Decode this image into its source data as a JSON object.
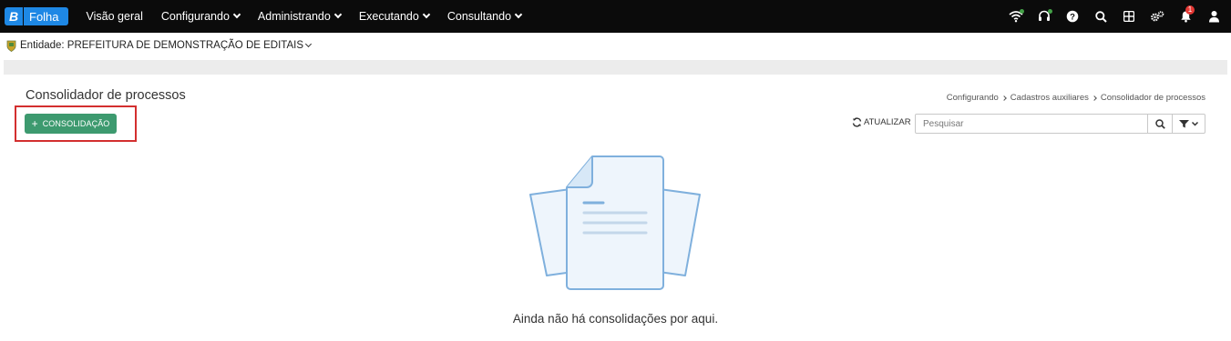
{
  "app": {
    "logo_letter": "B",
    "name": "Folha"
  },
  "nav": {
    "items": [
      {
        "label": "Visão geral",
        "has_dropdown": false
      },
      {
        "label": "Configurando",
        "has_dropdown": true
      },
      {
        "label": "Administrando",
        "has_dropdown": true
      },
      {
        "label": "Executando",
        "has_dropdown": true
      },
      {
        "label": "Consultando",
        "has_dropdown": true
      }
    ],
    "notifications_count": "1"
  },
  "entity": {
    "label": "Entidade: PREFEITURA DE DEMONSTRAÇÃO DE EDITAIS"
  },
  "page": {
    "title": "Consolidador de processos",
    "breadcrumb": [
      "Configurando",
      "Cadastros auxiliares",
      "Consolidador de processos"
    ]
  },
  "toolbar": {
    "add_label": "CONSOLIDAÇÃO",
    "refresh_label": "ATUALIZAR",
    "search_placeholder": "Pesquisar"
  },
  "empty_state": {
    "message": "Ainda não há consolidações por aqui."
  },
  "colors": {
    "topbar": "#0b0b0b",
    "brand": "#1e88e5",
    "primary_button": "#3d9a6f",
    "highlight": "#d32f2f",
    "illustration_stroke": "#7fb0dd",
    "illustration_fill": "#eef5fc"
  }
}
